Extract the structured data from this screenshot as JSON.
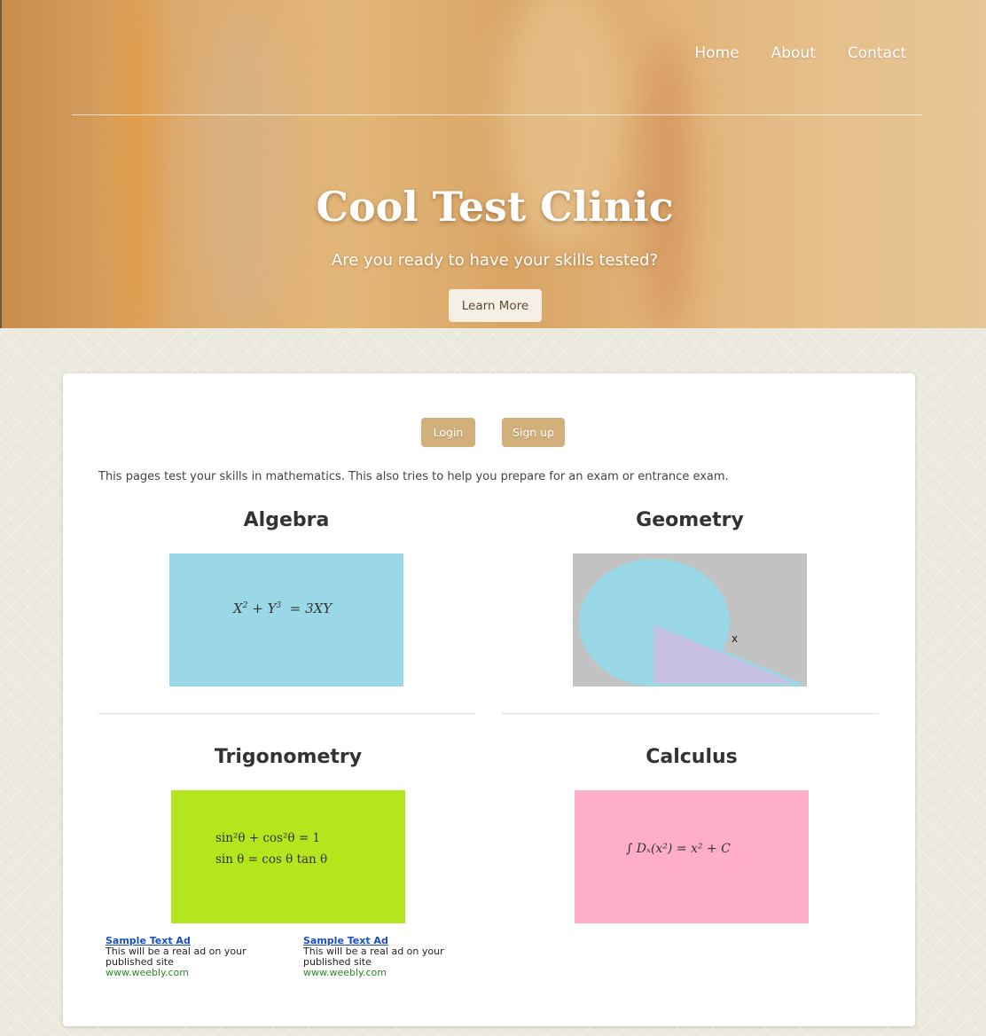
{
  "nav": {
    "items": [
      {
        "label": "Home"
      },
      {
        "label": "About"
      },
      {
        "label": "Contact"
      }
    ]
  },
  "hero": {
    "title": "Cool Test Clinic",
    "subtitle": "Are you ready to have your skills tested?",
    "cta_label": "Learn More"
  },
  "auth": {
    "login_label": "Login",
    "signup_label": "Sign up"
  },
  "intro_text": "This pages test your skills in mathematics. This also tries to help you prepare for an exam or entrance exam.",
  "sections": {
    "algebra": {
      "title": "Algebra",
      "tile_color": "#9ad8e8",
      "formula": {
        "lhs": "X",
        "p1": "2",
        "plus": "+",
        "y": "Y",
        "p2": "3",
        "rhs": "= 3XY"
      }
    },
    "geometry": {
      "title": "Geometry",
      "tile_color": "#c2c2c2",
      "circle_color": "#9ad8e8",
      "triangle_color": "#c7c1e4",
      "label_x": "x"
    },
    "trigonometry": {
      "title": "Trigonometry",
      "tile_color": "#b5e61d",
      "line1": "sin²θ + cos²θ = 1",
      "line2": "sin θ = cos θ tan θ"
    },
    "calculus": {
      "title": "Calculus",
      "tile_color": "#ffaec9",
      "formula": "∫ Dₓ(x²) = x² + C"
    }
  },
  "ads": [
    {
      "title": "Sample Text Ad",
      "body": "This will be a real ad on your published site",
      "url": "www.weebly.com"
    },
    {
      "title": "Sample Text Ad",
      "body": "This will be a real ad on your published site",
      "url": "www.weebly.com"
    }
  ]
}
